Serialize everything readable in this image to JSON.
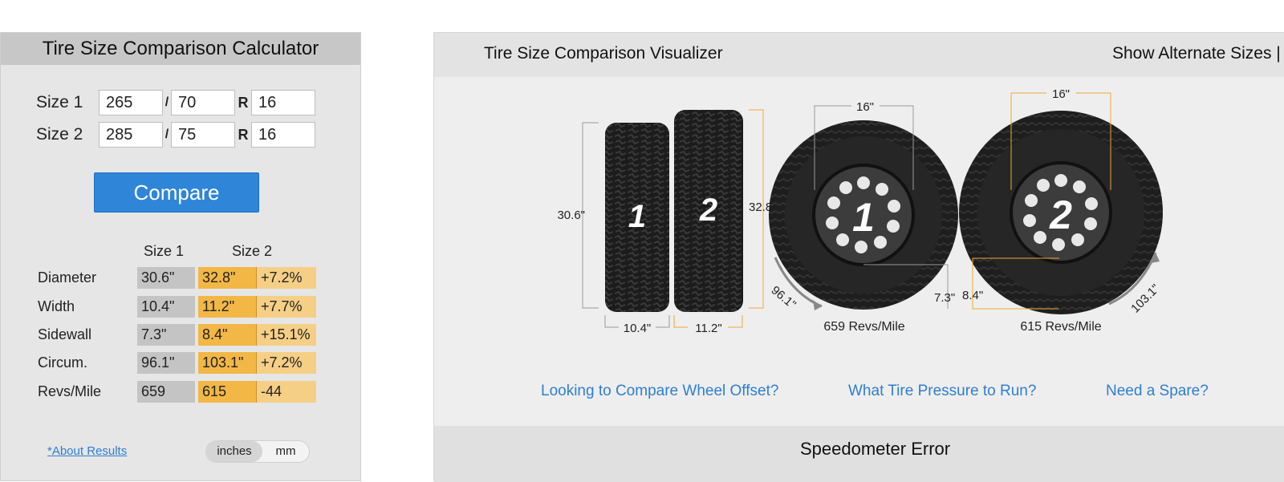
{
  "calculator": {
    "title": "Tire Size Comparison Calculator",
    "size1": {
      "label": "Size 1",
      "width": "265",
      "aspect": "70",
      "rim": "16"
    },
    "size2": {
      "label": "Size 2",
      "width": "285",
      "aspect": "75",
      "rim": "16"
    },
    "slash": "/",
    "r": "R",
    "compare_label": "Compare",
    "col1": "Size 1",
    "col2": "Size 2",
    "rows": [
      {
        "label": "Diameter",
        "v1": "30.6\"",
        "v2": "32.8\"",
        "diff": "+7.2%"
      },
      {
        "label": "Width",
        "v1": "10.4\"",
        "v2": "11.2\"",
        "diff": "+7.7%"
      },
      {
        "label": "Sidewall",
        "v1": "7.3\"",
        "v2": "8.4\"",
        "diff": "+15.1%"
      },
      {
        "label": "Circum.",
        "v1": "96.1\"",
        "v2": "103.1\"",
        "diff": "+7.2%"
      },
      {
        "label": "Revs/Mile",
        "v1": "659",
        "v2": "615",
        "diff": "-44"
      }
    ],
    "about_link": "*About Results",
    "unit_inches": "inches",
    "unit_mm": "mm"
  },
  "visualizer": {
    "title": "Tire Size Comparison Visualizer",
    "alt_sizes": "Show Alternate Sizes |",
    "tire1": {
      "number": "1",
      "height": "30.6\"",
      "width": "10.4\"",
      "rim": "16\"",
      "sidewall": "7.3\"",
      "circ": "96.1\"",
      "revs": "659 Revs/Mile"
    },
    "tire2": {
      "number": "2",
      "height": "32.8\"",
      "width": "11.2\"",
      "rim": "16\"",
      "sidewall": "8.4\"",
      "circ": "103.1\"",
      "revs": "615 Revs/Mile"
    },
    "links": [
      "Looking to Compare Wheel Offset?",
      "What Tire Pressure to Run?",
      "Need a Spare?"
    ],
    "speedo": "Speedometer Error"
  },
  "colors": {
    "accent": "#2f86d8",
    "orange": "#f2b745",
    "light_orange": "#f5cf85",
    "gray_cell": "#c4c4c4",
    "dim_gray": "#999999",
    "dim_orange": "#f0a830"
  }
}
